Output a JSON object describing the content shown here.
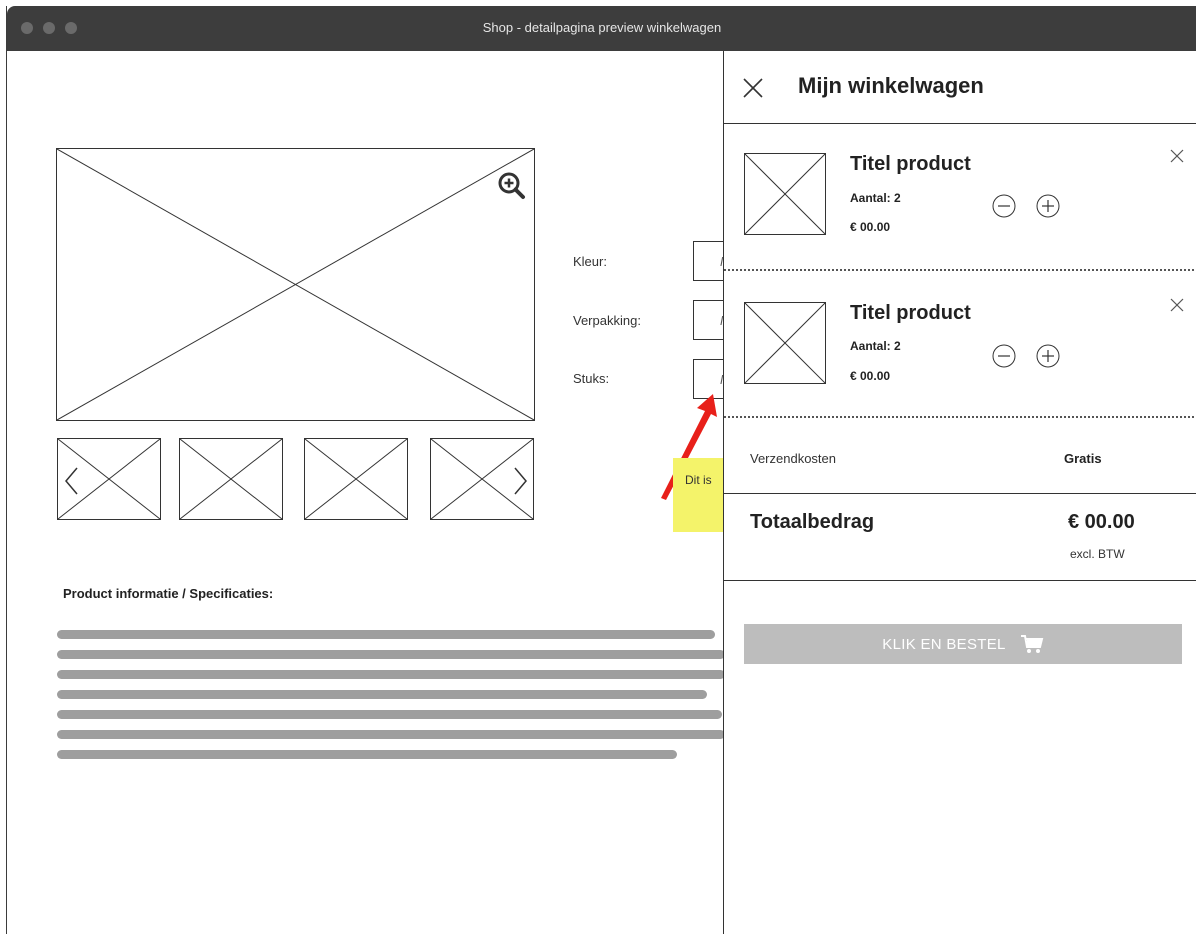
{
  "window": {
    "title": "Shop - detailpagina preview winkelwagen"
  },
  "product": {
    "options": [
      {
        "label": "Kleur:",
        "value": "M"
      },
      {
        "label": "Verpakking:",
        "value": "M"
      },
      {
        "label": "Stuks:",
        "value": "M"
      }
    ],
    "spec_title": "Product informatie / Specificaties:",
    "note_text": "Dit is"
  },
  "cart": {
    "title": "Mijn winkelwagen",
    "items": [
      {
        "title": "Titel product",
        "qty": "Aantal: 2",
        "price": "€ 00.00"
      },
      {
        "title": "Titel product",
        "qty": "Aantal: 2",
        "price": "€ 00.00"
      }
    ],
    "shipping_label": "Verzendkosten",
    "shipping_value": "Gratis",
    "total_label": "Totaalbedrag",
    "total_value": "€ 00.00",
    "vat_note": "excl. BTW",
    "order_button": "KLIK EN BESTEL"
  },
  "colors": {
    "button_bg": "#bdbdbd",
    "note_bg": "#f4f36a",
    "arrow": "#e8201a"
  },
  "icons": [
    "zoom-in-icon",
    "chevron-left-icon",
    "chevron-right-icon",
    "close-icon",
    "minus-circle-icon",
    "plus-circle-icon",
    "cart-icon"
  ]
}
